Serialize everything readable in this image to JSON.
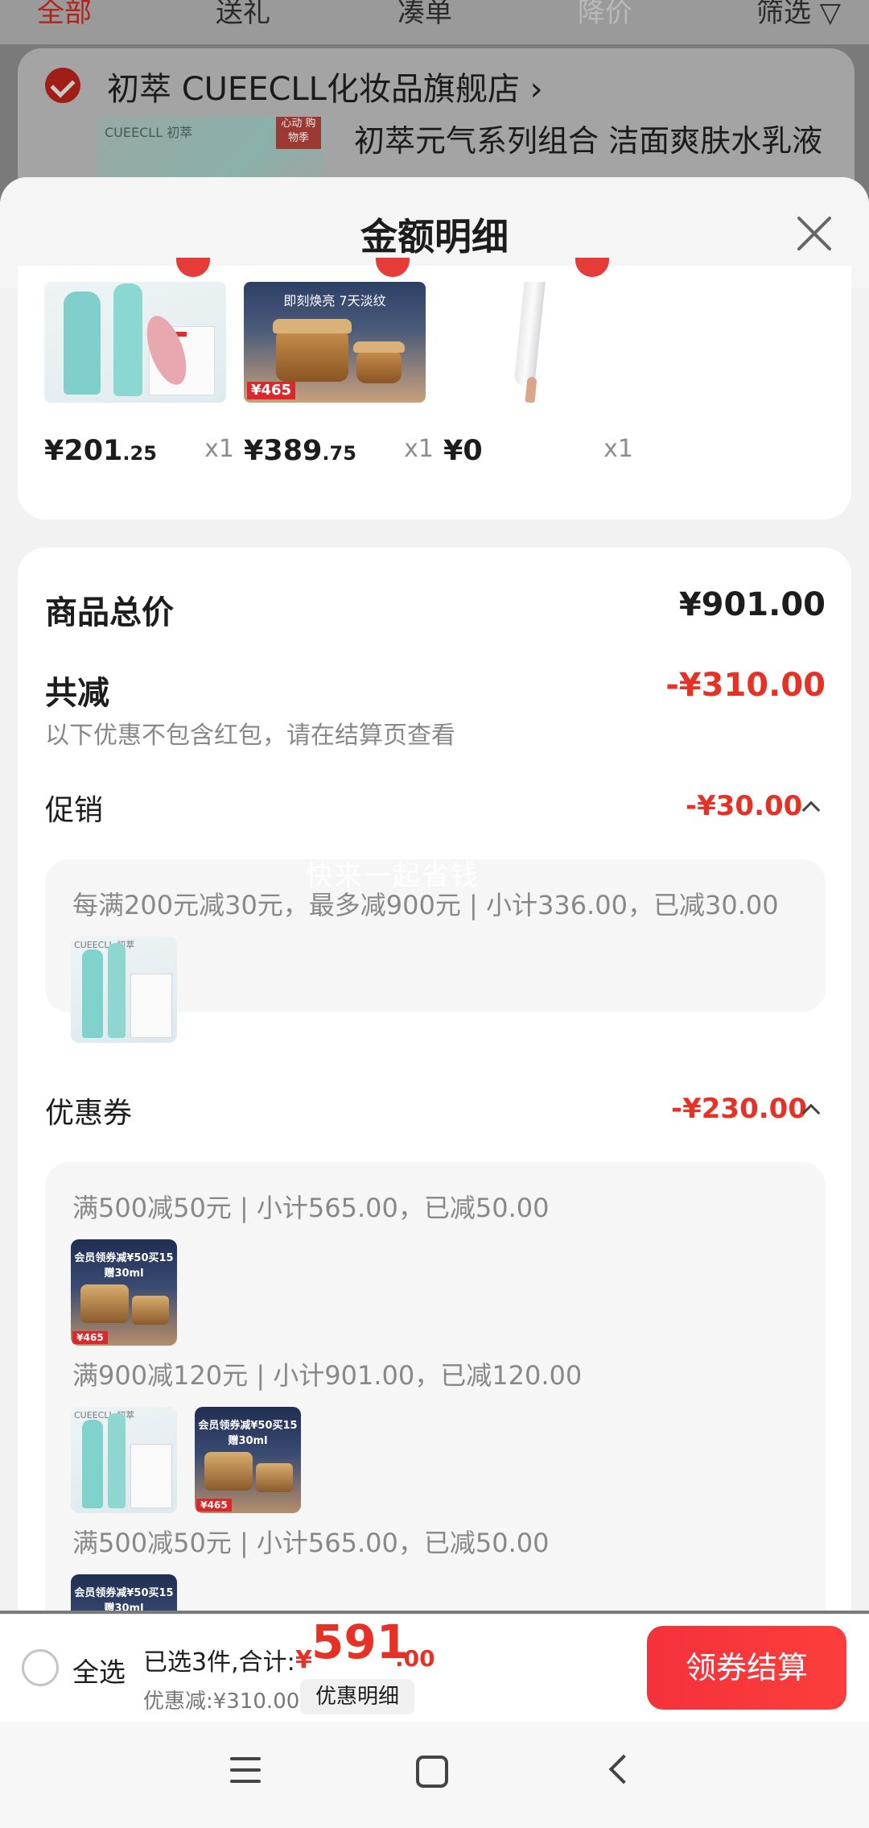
{
  "background": {
    "tabs": [
      "全部",
      "送礼",
      "凑单",
      "降价",
      "筛选 ▽"
    ],
    "shop_name": "初萃 CUEECLL化妆品旗舰店 ›",
    "product_title": "初萃元气系列组合 洁面爽肤水乳液",
    "thumb_brand": "CUEECLL 初萃",
    "thumb_tag": "心动 购物季"
  },
  "sheet": {
    "title": "金额明细"
  },
  "products": [
    {
      "price_int": "¥201",
      "price_dec": ".25",
      "qty": "x1",
      "image": "skincare-set"
    },
    {
      "price_int": "¥389",
      "price_dec": ".75",
      "qty": "x1",
      "image": "cream-jars",
      "image_caption": "即刻焕亮 7天淡纹",
      "image_badge": "¥465"
    },
    {
      "price_int": "¥0",
      "price_dec": "",
      "qty": "x1",
      "image": "pen"
    }
  ],
  "detail": {
    "total_label": "商品总价",
    "total_value": "¥901.00",
    "reduce_label": "共减",
    "reduce_value": "-¥310.00",
    "reduce_note": "以下优惠不包含红包，请在结算页查看",
    "promo_label": "促销",
    "promo_value": "-¥30.00",
    "promo_rule": "每满200元减30元，最多减900元 | 小计336.00，已减30.00",
    "coupon_label": "优惠券",
    "coupon_value": "-¥230.00",
    "coupons": [
      {
        "rule": "满500减50元 | 小计565.00，已减50.00"
      },
      {
        "rule": "满900减120元 | 小计901.00，已减120.00"
      },
      {
        "rule": "满500减50元 | 小计565.00，已减50.00"
      }
    ],
    "watermark": "快来一起省钱"
  },
  "thumbs": {
    "set_label": "CUEECLL 初萃",
    "cream_caption": "会员领券减¥50买15赠30ml",
    "cream_badge": "¥465"
  },
  "checkout": {
    "select_all": "全选",
    "summary": "已选3件,合计:",
    "currency": "¥",
    "total_int": "591",
    "total_dec": ".00",
    "discount": "优惠减:¥310.00",
    "detail_button": "优惠明细",
    "checkout_button": "领券结算"
  },
  "colors": {
    "accent_red": "#e63226",
    "button_red": "#f5313b"
  }
}
